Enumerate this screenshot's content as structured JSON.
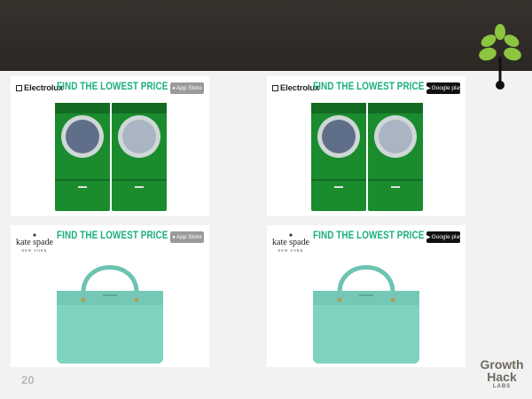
{
  "slide": {
    "page_number": "20",
    "colors": {
      "topbar": "#2f2c28",
      "headline": "#1bb07a",
      "washer": "#1a8c2e",
      "bag": "#7fd3c0",
      "leaf": "#8cc63f"
    }
  },
  "logo": {
    "icon": "growth-leaf-icon",
    "line1": "Growth",
    "line2": "Hack",
    "line3": "LABS"
  },
  "ads": [
    {
      "brand": "Electrolux",
      "headline": "FIND THE LOWEST PRICE",
      "store": "App Store",
      "product": "washer-dryer-pair"
    },
    {
      "brand": "Electrolux",
      "headline": "FIND THE LOWEST PRICE",
      "store": "Google play",
      "product": "washer-dryer-pair"
    },
    {
      "brand": "kate spade",
      "brand_sub": "NEW YORK",
      "headline": "FIND THE LOWEST PRICE",
      "store": "App Store",
      "product": "handbag"
    },
    {
      "brand": "kate spade",
      "brand_sub": "NEW YORK",
      "headline": "FIND THE LOWEST PRICE",
      "store": "Google play",
      "product": "handbag"
    }
  ]
}
